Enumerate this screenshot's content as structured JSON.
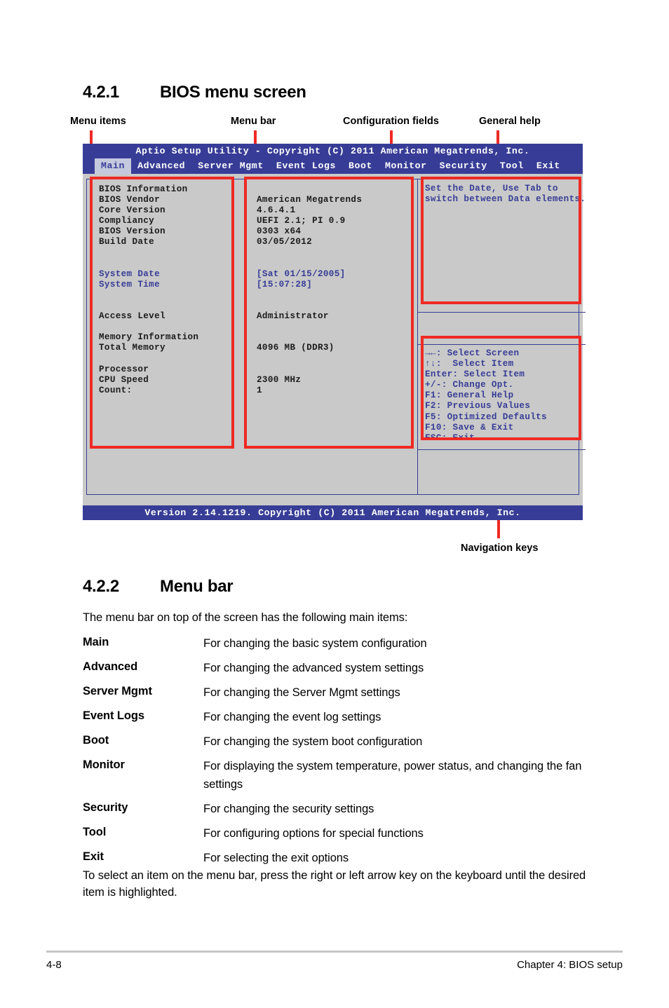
{
  "page": {
    "footer_page_number": "4-8",
    "footer_chapter": "Chapter 4: BIOS setup"
  },
  "section_421": {
    "number": "4.2.1",
    "title": "BIOS menu screen"
  },
  "callouts": {
    "menu_items": "Menu items",
    "menu_bar": "Menu bar",
    "configuration_fields": "Configuration fields",
    "general_help": "General help",
    "navigation_keys": "Navigation keys"
  },
  "bios": {
    "title": "Aptio Setup Utility - Copyright (C) 2011 American Megatrends, Inc.",
    "footer": "Version 2.14.1219. Copyright (C) 2011 American Megatrends, Inc.",
    "menu_tabs": [
      {
        "label": "Main",
        "active": true
      },
      {
        "label": "Advanced",
        "active": false
      },
      {
        "label": "Server Mgmt",
        "active": false
      },
      {
        "label": "Event Logs",
        "active": false
      },
      {
        "label": "Boot",
        "active": false
      },
      {
        "label": "Monitor",
        "active": false
      },
      {
        "label": "Security",
        "active": false
      },
      {
        "label": "Tool",
        "active": false
      },
      {
        "label": "Exit",
        "active": false
      }
    ],
    "rows": [
      {
        "item": "BIOS Information",
        "value": "",
        "highlight": false
      },
      {
        "item": "BIOS Vendor",
        "value": "American Megatrends",
        "highlight": false
      },
      {
        "item": "Core Version",
        "value": "4.6.4.1",
        "highlight": false
      },
      {
        "item": "Compliancy",
        "value": "UEFI 2.1; PI 0.9",
        "highlight": false
      },
      {
        "item": "BIOS Version",
        "value": "0303 x64",
        "highlight": false
      },
      {
        "item": "Build Date",
        "value": "03/05/2012",
        "highlight": false
      },
      {
        "item": "",
        "value": "",
        "highlight": false
      },
      {
        "item": "",
        "value": "",
        "highlight": false
      },
      {
        "item": "System Date",
        "value": "[Sat 01/15/2005]",
        "highlight": true
      },
      {
        "item": "System Time",
        "value": "[15:07:28]",
        "highlight": true
      },
      {
        "item": "",
        "value": "",
        "highlight": false
      },
      {
        "item": "",
        "value": "",
        "highlight": false
      },
      {
        "item": "Access Level",
        "value": "Administrator",
        "highlight": false
      },
      {
        "item": "",
        "value": "",
        "highlight": false
      },
      {
        "item": "Memory Information",
        "value": "",
        "highlight": false
      },
      {
        "item": "Total Memory",
        "value": "4096 MB (DDR3)",
        "highlight": false
      },
      {
        "item": "",
        "value": "",
        "highlight": false
      },
      {
        "item": "Processor",
        "value": "",
        "highlight": false
      },
      {
        "item": "CPU Speed",
        "value": "2300 MHz",
        "highlight": false
      },
      {
        "item": "Count:",
        "value": "1",
        "highlight": false
      }
    ],
    "help_text": "Set the Date, Use Tab to\nswitch between Data elements.",
    "nav_keys": "→←: Select Screen\n↑↓:  Select Item\nEnter: Select Item\n+/-: Change Opt.\nF1: General Help\nF2: Previous Values\nF5: Optimized Defaults\nF10: Save & Exit\nESC: Exit",
    "colors": {
      "chrome_blue": "#373d96",
      "screen_gray": "#c9c9c9",
      "active_tab_bg": "#c5c9de",
      "annotation_red": "#ee2a24"
    }
  },
  "section_422": {
    "number": "4.2.2",
    "title": "Menu bar",
    "intro": "The menu bar on top of the screen has the following main items:",
    "items": [
      {
        "term": "Main",
        "desc": "For changing the basic system configuration"
      },
      {
        "term": "Advanced",
        "desc": "For changing the advanced system settings"
      },
      {
        "term": "Server Mgmt",
        "desc": "For changing the Server Mgmt settings"
      },
      {
        "term": "Event Logs",
        "desc": "For changing the event log settings"
      },
      {
        "term": "Boot",
        "desc": "For changing the system boot configuration"
      },
      {
        "term": "Monitor",
        "desc": "For displaying the system temperature, power status, and changing the fan settings"
      },
      {
        "term": "Security",
        "desc": "For changing the security settings"
      },
      {
        "term": "Tool",
        "desc": "For configuring options for special functions"
      },
      {
        "term": "Exit",
        "desc": "For selecting the exit options"
      }
    ],
    "outro": "To select an item on the menu bar, press the right or left arrow key on the keyboard until the desired item is highlighted."
  }
}
